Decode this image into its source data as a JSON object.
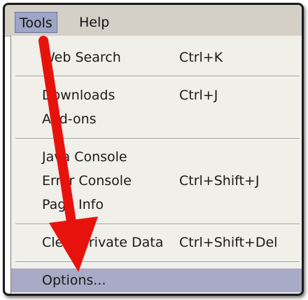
{
  "menubar": {
    "items": [
      {
        "label": "Tools"
      },
      {
        "label": "Help"
      }
    ]
  },
  "menu": {
    "items": [
      {
        "label": "Web Search",
        "shortcut": "Ctrl+K"
      },
      {
        "label": "Downloads",
        "shortcut": "Ctrl+J"
      },
      {
        "label": "Add-ons",
        "shortcut": ""
      },
      {
        "label": "Java Console",
        "shortcut": ""
      },
      {
        "label": "Error Console",
        "shortcut": "Ctrl+Shift+J"
      },
      {
        "label": "Page Info",
        "shortcut": ""
      },
      {
        "label": "Clear Private Data",
        "shortcut": "Ctrl+Shift+Del"
      },
      {
        "label": "Options...",
        "shortcut": ""
      }
    ]
  },
  "colors": {
    "arrow": "#e8120c",
    "highlight": "#a9aac6",
    "menubar_active": "#9ea5c6"
  }
}
